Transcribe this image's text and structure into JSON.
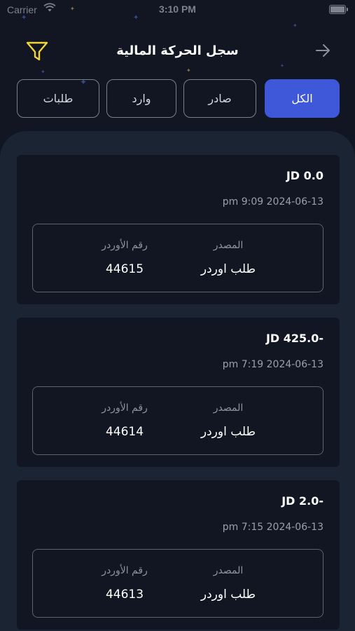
{
  "status_bar": {
    "carrier": "Carrier",
    "time": "3:10 PM"
  },
  "header": {
    "title": "سجل الحركة المالية",
    "filter_icon": "filter-icon",
    "back_icon": "arrow-right-icon"
  },
  "colors": {
    "accent": "#3f57d9",
    "background": "#111622",
    "sheet": "#1b2432",
    "filter_icon": "#f2d33a"
  },
  "tabs": [
    {
      "label": "الكل",
      "active": true
    },
    {
      "label": "صادر",
      "active": false
    },
    {
      "label": "وارد",
      "active": false
    },
    {
      "label": "طلبات",
      "active": false
    }
  ],
  "transactions": [
    {
      "amount": "JD 0.0",
      "datetime": "pm 9:09 2024-06-13",
      "source_label": "المصدر",
      "source_value": "طلب اوردر",
      "order_label": "رقم الأوردر",
      "order_value": "44615"
    },
    {
      "amount": "JD 425.0-",
      "datetime": "pm 7:19 2024-06-13",
      "source_label": "المصدر",
      "source_value": "طلب اوردر",
      "order_label": "رقم الأوردر",
      "order_value": "44614"
    },
    {
      "amount": "JD 2.0-",
      "datetime": "pm 7:15 2024-06-13",
      "source_label": "المصدر",
      "source_value": "طلب اوردر",
      "order_label": "رقم الأوردر",
      "order_value": "44613"
    }
  ]
}
